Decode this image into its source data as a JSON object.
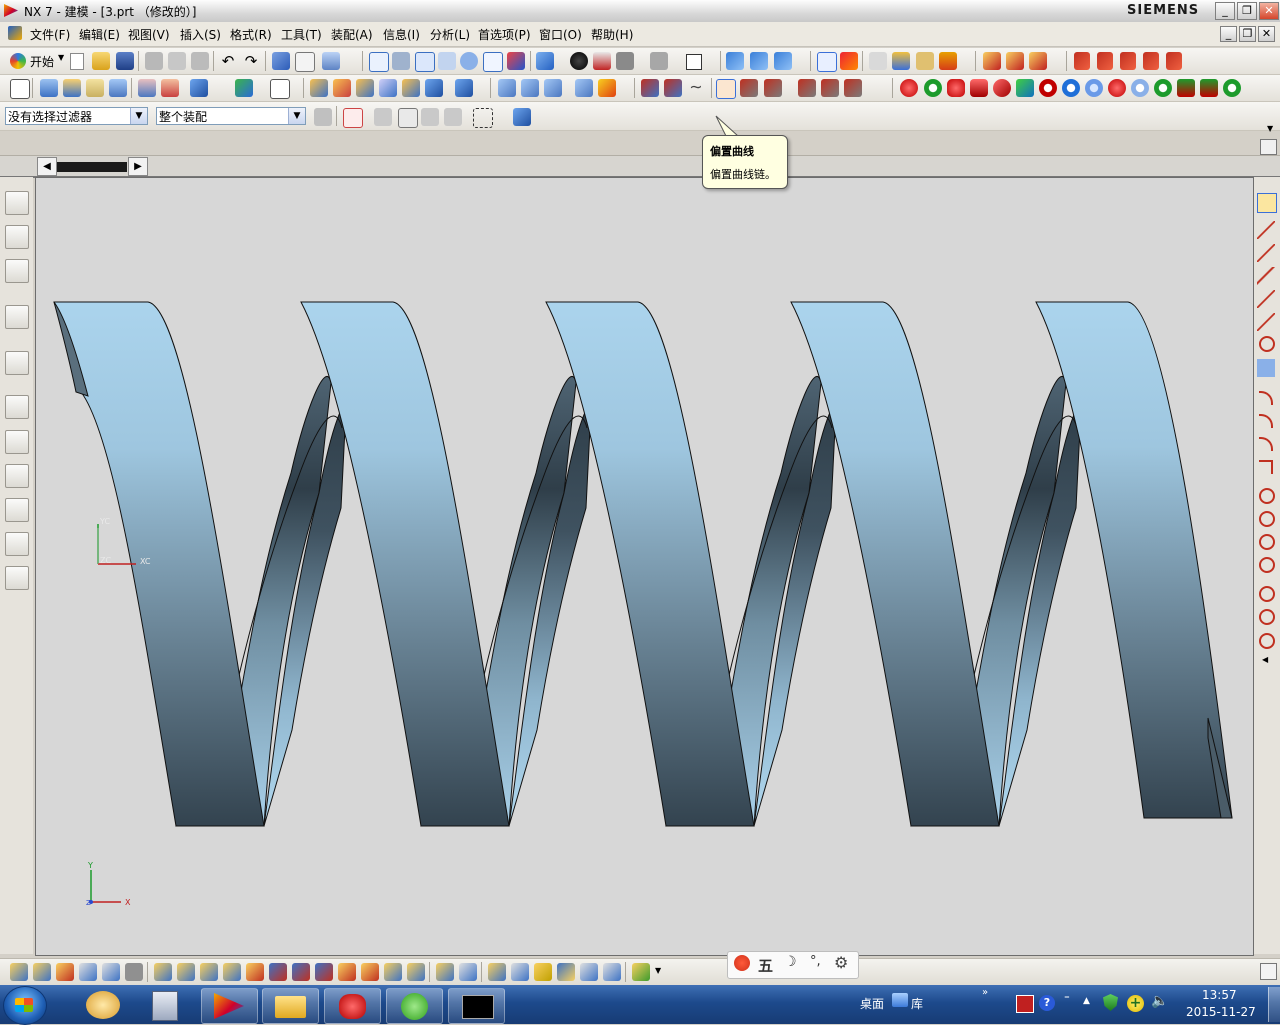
{
  "window": {
    "title": "NX 7 - 建模 - [3.prt （修改的）]",
    "brand": "SIEMENS",
    "controls": [
      "_",
      "❐",
      "✕"
    ]
  },
  "menubar": {
    "items": [
      "文件(F)",
      "编辑(E)",
      "视图(V)",
      "插入(S)",
      "格式(R)",
      "工具(T)",
      "装配(A)",
      "信息(I)",
      "分析(L)",
      "首选项(P)",
      "窗口(O)",
      "帮助(H)"
    ]
  },
  "toolbar1": {
    "start_label": "开始"
  },
  "filters": {
    "selection_filter": "没有选择过滤器",
    "assembly_scope": "整个装配"
  },
  "tooltip": {
    "title": "偏置曲线",
    "description": "偏置曲线链。"
  },
  "viewport": {
    "wcs_axes": {
      "y": "YC",
      "x": "XC",
      "z": "ZC"
    },
    "abs_axes": {
      "y": "Y",
      "x": "X",
      "z": "Z"
    }
  },
  "ime": {
    "mode": "五"
  },
  "taskbar": {
    "tray_label": "桌面",
    "tray_library": "库",
    "time": "13:57",
    "date": "2015-11-27"
  },
  "colors": {
    "spring_light": "#a8cfe6",
    "spring_dark": "#33434f",
    "viewport_bg": "#d7d7d7"
  }
}
